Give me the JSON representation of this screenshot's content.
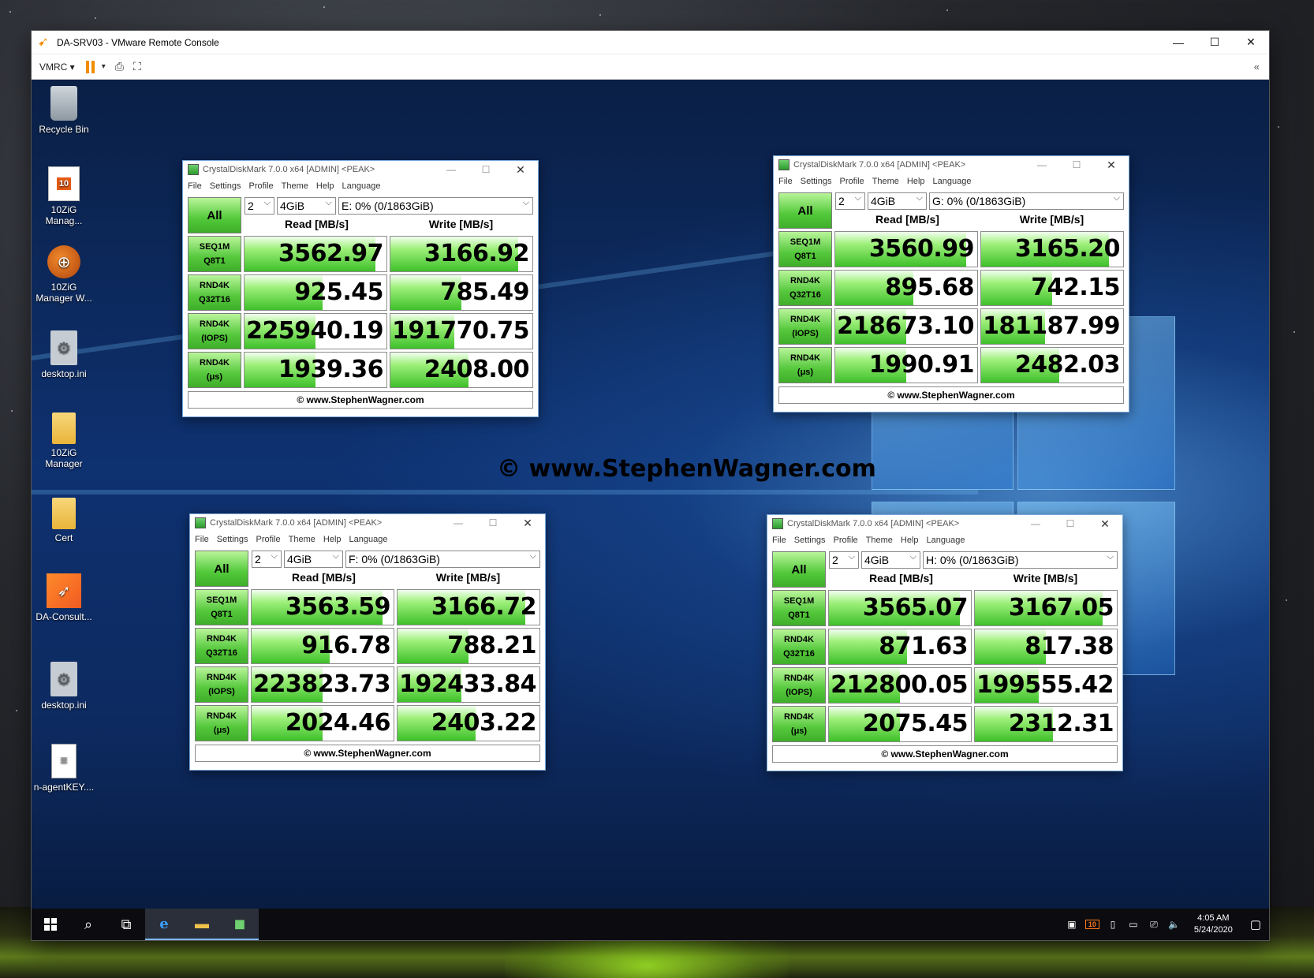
{
  "vmrc": {
    "title": "DA-SRV03 - VMware Remote Console",
    "menu_label": "VMRC ▾"
  },
  "desktop_icons": [
    {
      "label": "Recycle Bin"
    },
    {
      "label": "10ZiG Manag..."
    },
    {
      "label": "10ZiG Manager W..."
    },
    {
      "label": "desktop.ini"
    },
    {
      "label": "10ZiG Manager"
    },
    {
      "label": "Cert"
    },
    {
      "label": "DA-Consult..."
    },
    {
      "label": "desktop.ini"
    },
    {
      "label": "n-agentKEY...."
    }
  ],
  "watermark": "© www.StephenWagner.com",
  "cdm_common": {
    "title": "CrystalDiskMark 7.0.0 x64 [ADMIN] <PEAK>",
    "menu": [
      "File",
      "Settings",
      "Profile",
      "Theme",
      "Help",
      "Language"
    ],
    "all_label": "All",
    "count": "2",
    "size": "4GiB",
    "read_header": "Read [MB/s]",
    "write_header": "Write [MB/s]",
    "row_labels": [
      {
        "l1": "SEQ1M",
        "l2": "Q8T1"
      },
      {
        "l1": "RND4K",
        "l2": "Q32T16"
      },
      {
        "l1": "RND4K",
        "l2": "(IOPS)"
      },
      {
        "l1": "RND4K",
        "l2": "(μs)"
      }
    ],
    "footer": "© www.StephenWagner.com"
  },
  "cdm_windows": [
    {
      "drive": "E: 0% (0/1863GiB)",
      "read": [
        "3562.97",
        "925.45",
        "225940.19",
        "1939.36"
      ],
      "write": [
        "3166.92",
        "785.49",
        "191770.75",
        "2408.00"
      ],
      "read_fill": [
        0.92,
        0.55,
        0.5,
        0.5
      ],
      "write_fill": [
        0.9,
        0.5,
        0.45,
        0.55
      ]
    },
    {
      "drive": "G: 0% (0/1863GiB)",
      "read": [
        "3560.99",
        "895.68",
        "218673.10",
        "1990.91"
      ],
      "write": [
        "3165.20",
        "742.15",
        "181187.99",
        "2482.03"
      ],
      "read_fill": [
        0.92,
        0.55,
        0.5,
        0.5
      ],
      "write_fill": [
        0.9,
        0.5,
        0.45,
        0.55
      ]
    },
    {
      "drive": "F: 0% (0/1863GiB)",
      "read": [
        "3563.59",
        "916.78",
        "223823.73",
        "2024.46"
      ],
      "write": [
        "3166.72",
        "788.21",
        "192433.84",
        "2403.22"
      ],
      "read_fill": [
        0.92,
        0.55,
        0.5,
        0.5
      ],
      "write_fill": [
        0.9,
        0.5,
        0.45,
        0.55
      ]
    },
    {
      "drive": "H: 0% (0/1863GiB)",
      "read": [
        "3565.07",
        "871.63",
        "212800.05",
        "2075.45"
      ],
      "write": [
        "3167.05",
        "817.38",
        "199555.42",
        "2312.31"
      ],
      "read_fill": [
        0.92,
        0.55,
        0.5,
        0.5
      ],
      "write_fill": [
        0.9,
        0.5,
        0.45,
        0.55
      ]
    }
  ],
  "taskbar": {
    "clock_time": "4:05 AM",
    "clock_date": "5/24/2020",
    "tray_10zig": "10"
  }
}
